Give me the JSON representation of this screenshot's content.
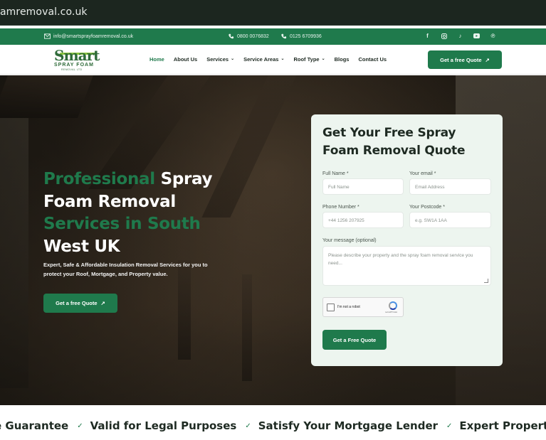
{
  "browser": {
    "url": "amremoval.co.uk"
  },
  "topbar": {
    "email": "info@smartsprayfoamremoval.co.uk",
    "phone1": "0800 0076832",
    "phone2": "0125 6709936",
    "social_icons": [
      "facebook-icon",
      "instagram-icon",
      "tiktok-icon",
      "youtube-icon",
      "pinterest-icon"
    ]
  },
  "logo": {
    "main": "Smart",
    "sub": "SPRAY FOAM",
    "sub2": "REMOVAL LTD"
  },
  "nav": {
    "items": [
      {
        "label": "Home",
        "active": true,
        "dropdown": false
      },
      {
        "label": "About Us",
        "active": false,
        "dropdown": false
      },
      {
        "label": "Services",
        "active": false,
        "dropdown": true
      },
      {
        "label": "Service Areas",
        "active": false,
        "dropdown": true
      },
      {
        "label": "Roof Type",
        "active": false,
        "dropdown": true
      },
      {
        "label": "Blogs",
        "active": false,
        "dropdown": false
      },
      {
        "label": "Contact Us",
        "active": false,
        "dropdown": false
      }
    ],
    "cta": "Get a free Quote"
  },
  "hero": {
    "headline_g1": "Professional",
    "headline_w1": " Spray Foam Removal",
    "headline_g2": "Services in South",
    "headline_w2": "West UK",
    "subtext": "Expert, Safe & Affordable Insulation Removal Services for you to protect your Roof, Mortgage, and Property value.",
    "cta": "Get a free Quote"
  },
  "form": {
    "title": "Get Your Free Spray Foam Removal Quote",
    "full_name_label": "Full Name *",
    "full_name_placeholder": "Full Name",
    "email_label": "Your email *",
    "email_placeholder": "Email Address",
    "phone_label": "Phone Number *",
    "phone_placeholder": "+44 1256 207925",
    "postcode_label": "Your Postcode *",
    "postcode_placeholder": "e.g. SW1A 1AA",
    "message_label": "Your message (optional)",
    "message_placeholder": "Please describe your property and the spray foam removal service you need...",
    "captcha_text": "I'm not a robot",
    "captcha_brand": "reCAPTCHA",
    "submit": "Get a Free Quote"
  },
  "marquee": [
    "e Guarantee",
    "Valid for Legal Purposes",
    "Satisfy Your Mortgage Lender",
    "Expert Property Ass"
  ],
  "colors": {
    "brand_green": "#1f7a4c",
    "hero_green_text": "#1f7a4c",
    "card_bg": "#edf5ef"
  }
}
